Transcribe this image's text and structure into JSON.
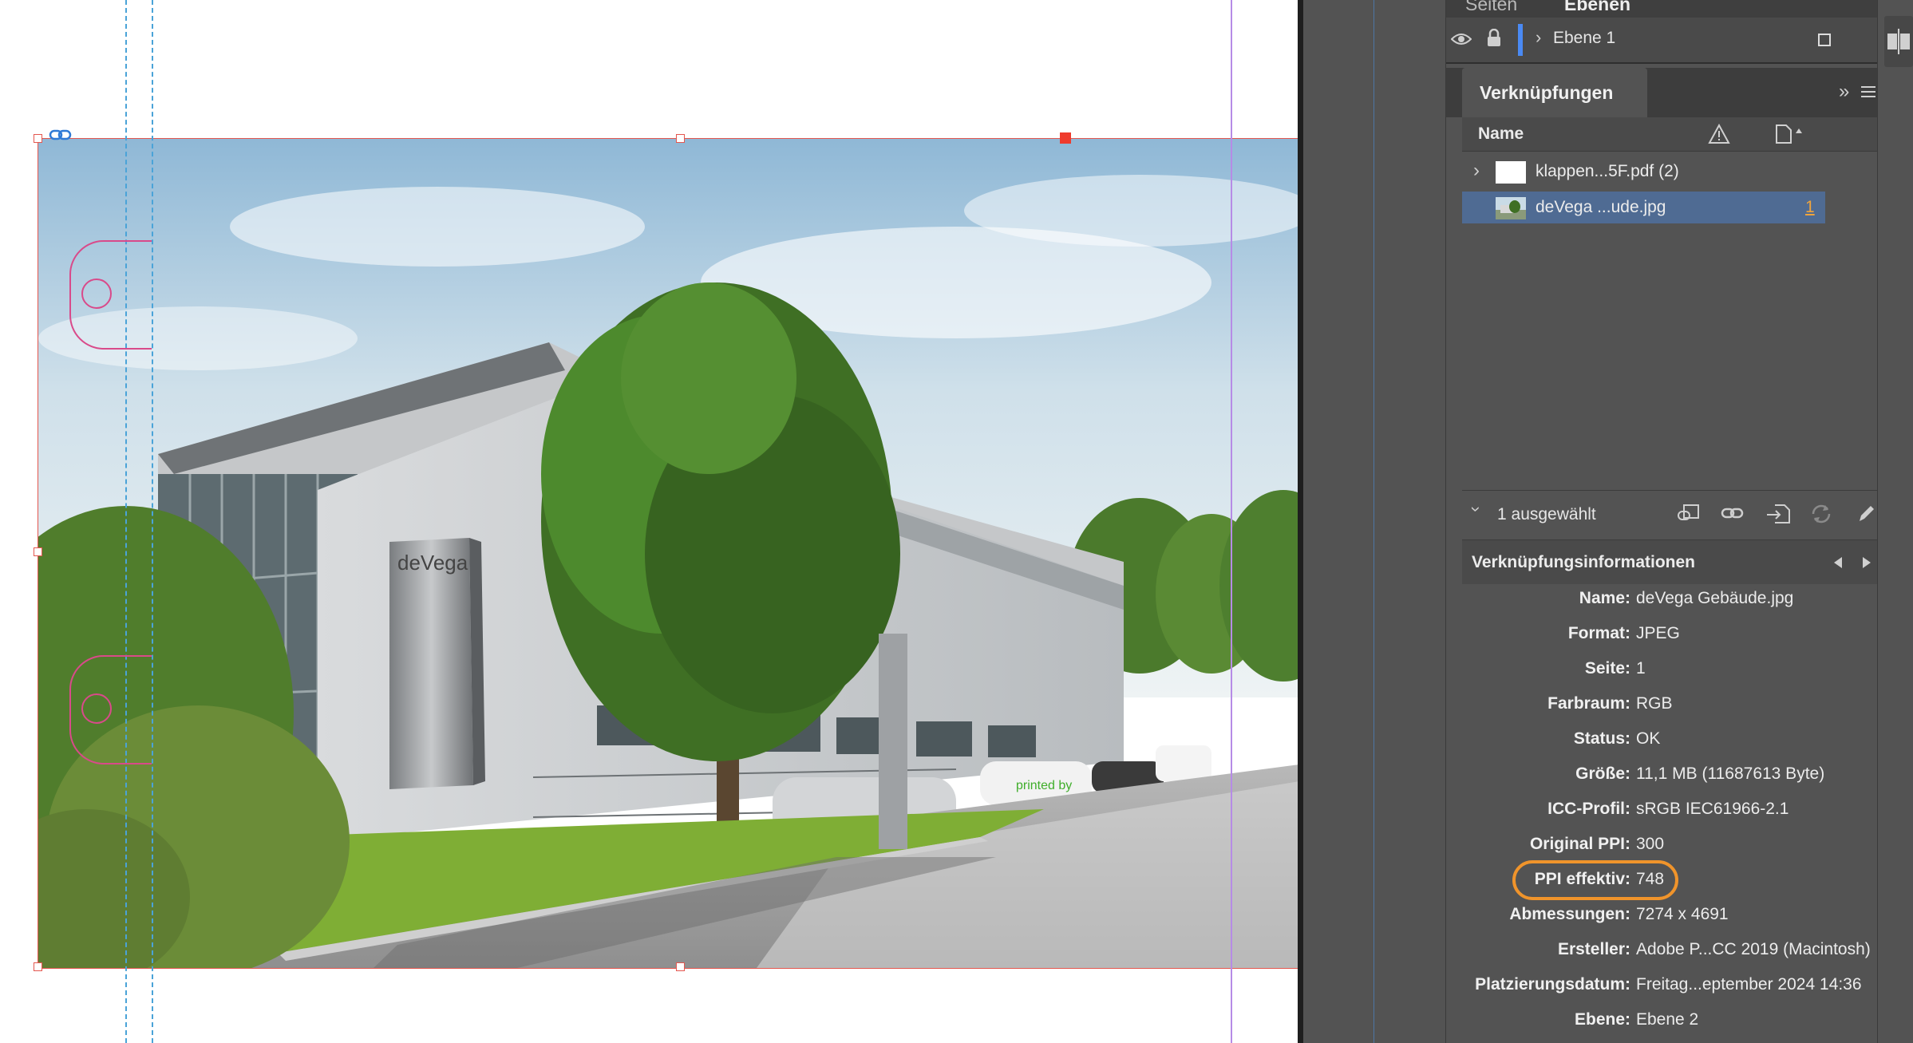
{
  "layers_panel": {
    "tab_pages": "Seiten",
    "tab_layers": "Ebenen",
    "layer_name": "Ebene 1"
  },
  "links_panel": {
    "title": "Verknüpfungen",
    "col_name": "Name",
    "items": [
      {
        "name": "klappen...5F.pdf (2)",
        "page": ""
      },
      {
        "name": "deVega ...ude.jpg",
        "page": "1"
      }
    ],
    "selection_status": "1 ausgewählt"
  },
  "link_info": {
    "title": "Verknüpfungsinformationen",
    "rows": [
      {
        "label": "Name:",
        "value": "deVega Gebäude.jpg"
      },
      {
        "label": "Format:",
        "value": "JPEG"
      },
      {
        "label": "Seite:",
        "value": "1"
      },
      {
        "label": "Farbraum:",
        "value": "RGB"
      },
      {
        "label": "Status:",
        "value": "OK"
      },
      {
        "label": "Größe:",
        "value": "11,1 MB (11687613 Byte)"
      },
      {
        "label": "ICC-Profil:",
        "value": "sRGB IEC61966-2.1"
      },
      {
        "label": "Original PPI:",
        "value": "300"
      },
      {
        "label": "PPI effektiv:",
        "value": "748"
      },
      {
        "label": "Abmessungen:",
        "value": "7274 x 4691"
      },
      {
        "label": "Ersteller:",
        "value": "Adobe P...CC 2019 (Macintosh)"
      },
      {
        "label": "Platzierungsdatum:",
        "value": "Freitag...eptember 2024 14:36"
      },
      {
        "label": "Ebene:",
        "value": "Ebene 2"
      }
    ]
  },
  "photo": {
    "sign_text": "deVega",
    "van_text": "printed by"
  },
  "colors": {
    "accent_selection": "#4f6b93",
    "highlight_ring": "#f0942b",
    "frame_edge": "#e4574f"
  }
}
